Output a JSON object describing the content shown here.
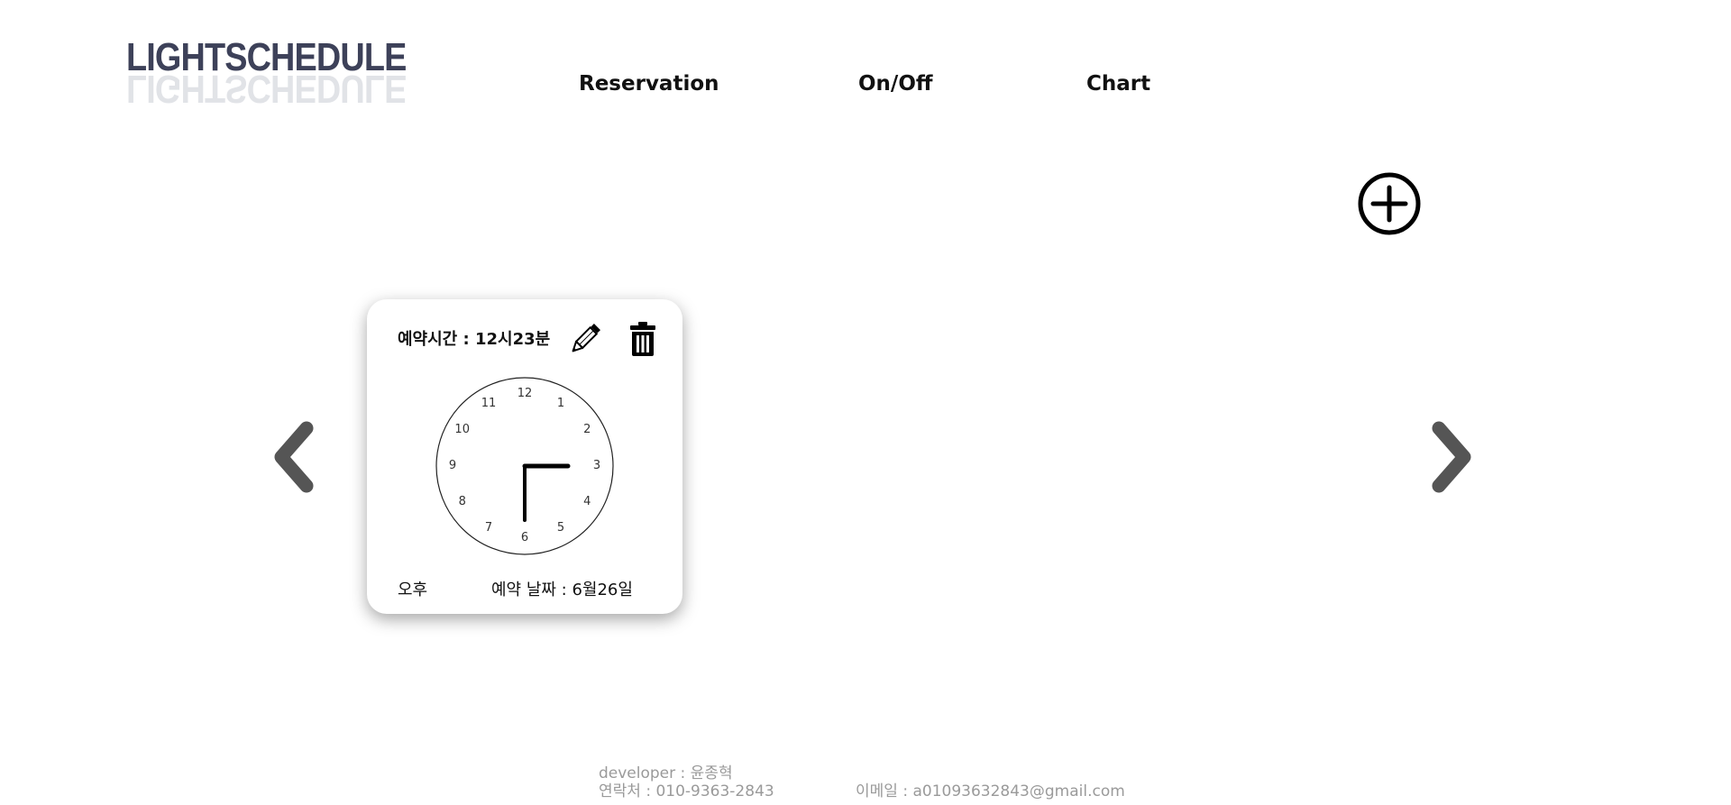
{
  "logo": {
    "text": "LIGHTSCHEDULE"
  },
  "nav": {
    "reservation": "Reservation",
    "onoff": "On/Off",
    "chart": "Chart"
  },
  "icons": {
    "add": "plus-circle-icon",
    "prev": "chevron-left-icon",
    "next": "chevron-right-icon",
    "edit": "pencil-icon",
    "delete": "trash-icon"
  },
  "reservation_card": {
    "title": "예약시간 : 12시23분",
    "clock": {
      "numbers": [
        "12",
        "1",
        "2",
        "3",
        "4",
        "5",
        "6",
        "7",
        "8",
        "9",
        "10",
        "11"
      ],
      "hour_hand_angle_deg": 90,
      "minute_hand_angle_deg": 180
    },
    "ampm": "오후",
    "date": "예약 날짜 : 6월26일"
  },
  "footer": {
    "developer": "developer : 윤종혁",
    "contact": "연락처 : 010-9363-2843",
    "email": "이메일 : a01093632843@gmail.com"
  },
  "colors": {
    "logo": "#3d4159",
    "arrow": "#555555",
    "footer_text": "#9a9a9a"
  }
}
